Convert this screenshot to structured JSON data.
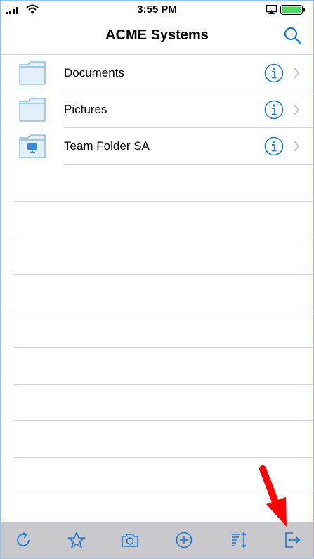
{
  "status_bar": {
    "time": "3:55 PM"
  },
  "nav": {
    "title": "ACME Systems"
  },
  "folders": [
    {
      "label": "Documents"
    },
    {
      "label": "Pictures"
    },
    {
      "label": "Team Folder SA"
    }
  ],
  "colors": {
    "accent": "#1a7bd6",
    "folder_fill": "#e3f0fb",
    "folder_stroke": "#5ea4dc",
    "toolbar_bg": "#c8c8cc",
    "annotation": "#ff0000"
  },
  "toolbar": {
    "icons": [
      "refresh-icon",
      "star-icon",
      "camera-icon",
      "add-circle-icon",
      "sort-icon",
      "logout-icon"
    ]
  }
}
